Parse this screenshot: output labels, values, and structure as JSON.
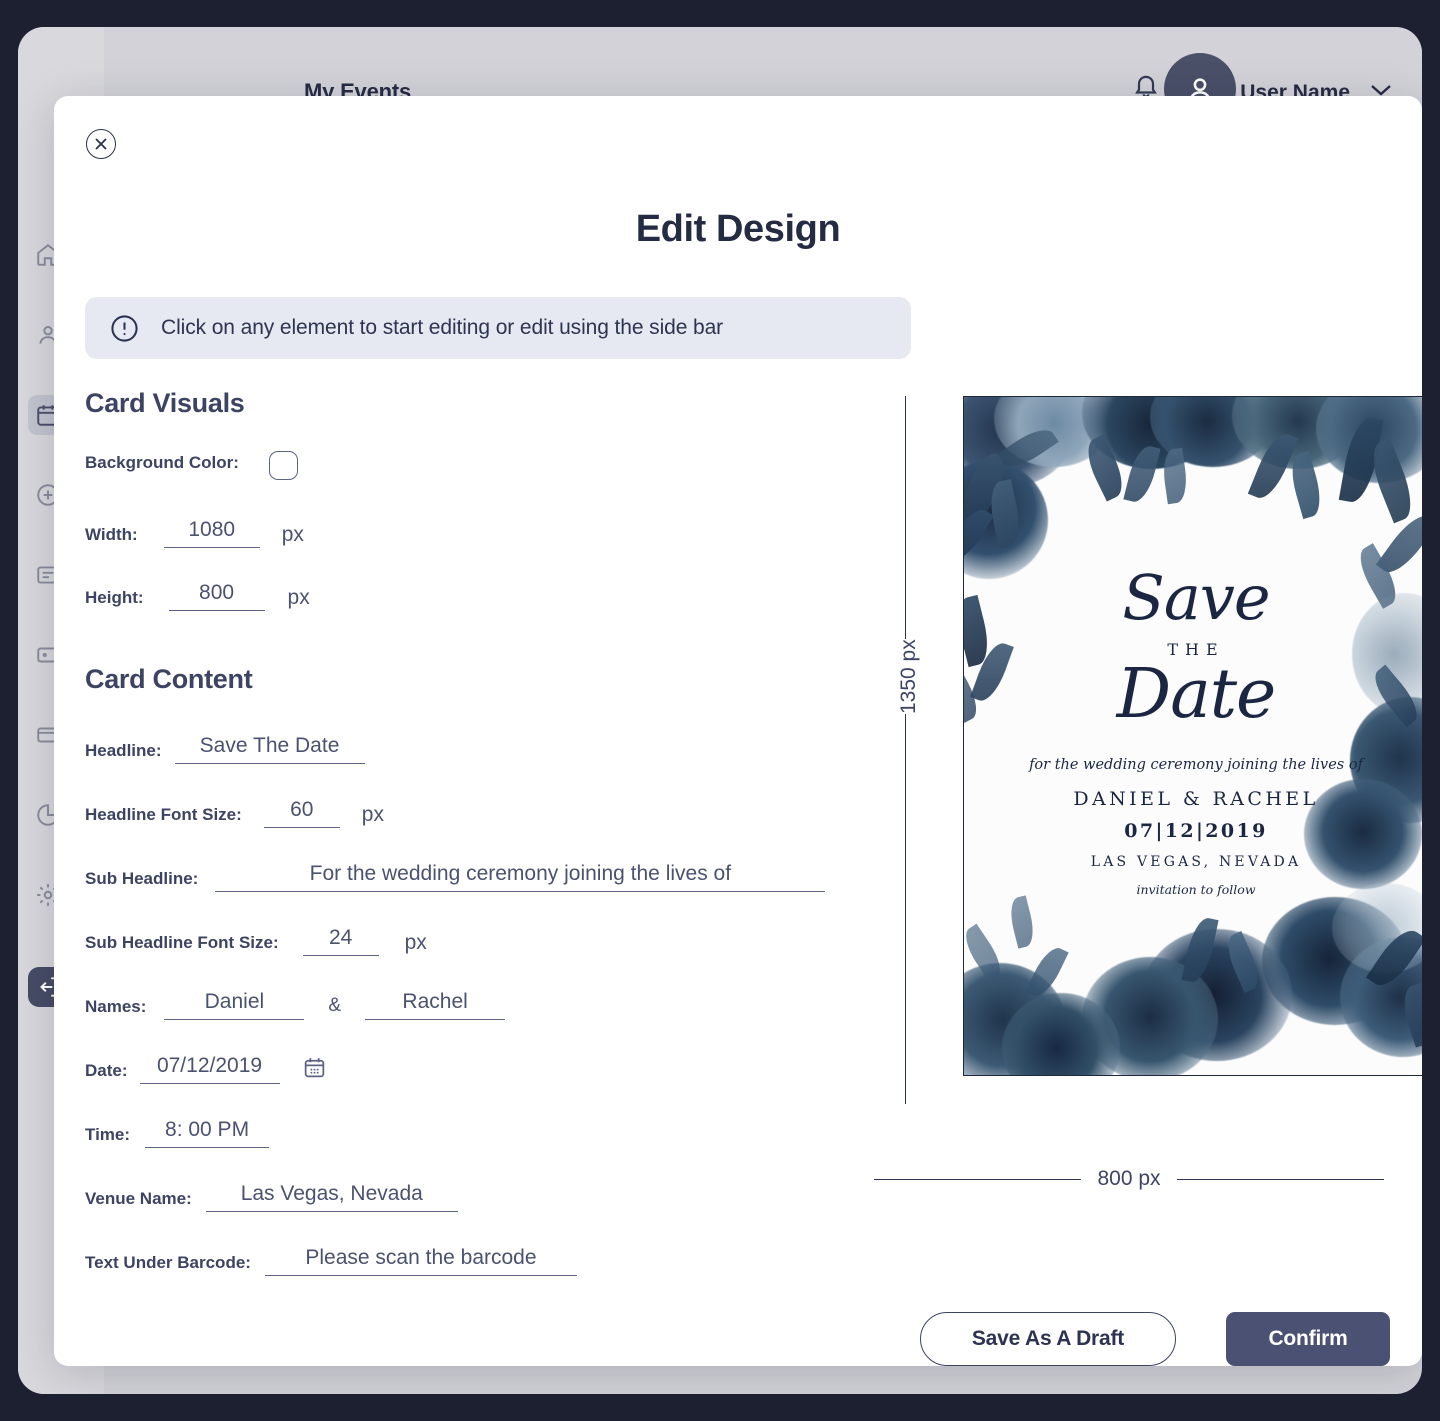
{
  "background_app": {
    "topbar_title": "My Events",
    "user_name": "User Name",
    "bell_icon": "bell-icon",
    "avatar_icon": "user-avatar-icon",
    "chevron_icon": "chevron-down-icon"
  },
  "modal": {
    "title": "Edit Design",
    "close_icon": "close-icon",
    "banner": {
      "icon": "info-exclamation-icon",
      "text": "Click on any  element to start editing or edit using the side bar"
    },
    "sections": {
      "visuals_title": "Card Visuals",
      "content_title": "Card Content"
    },
    "fields": {
      "background_color_label": "Background Color:",
      "background_color_value": "#FFFFFF",
      "width_label": "Width:",
      "width_value": "1080",
      "width_unit": "px",
      "height_label": "Height:",
      "height_value": "800",
      "height_unit": "px",
      "headline_label": "Headline:",
      "headline_value": "Save The Date",
      "headline_fs_label": "Headline Font Size:",
      "headline_fs_value": "60",
      "headline_fs_unit": "px",
      "subheadline_label": "Sub Headline:",
      "subheadline_value": "For the wedding ceremony joining the lives of",
      "subheadline_fs_label": "Sub Headline Font Size:",
      "subheadline_fs_value": "24",
      "subheadline_fs_unit": "px",
      "names_label": "Names:",
      "name_first_value": "Daniel",
      "names_separator": "&",
      "name_second_value": "Rachel",
      "date_label": "Date:",
      "date_value": "07/12/2019",
      "date_icon": "calendar-icon",
      "time_label": "Time:",
      "time_value": "8: 00 PM",
      "venue_label": "Venue Name:",
      "venue_value": "Las Vegas, Nevada",
      "barcode_label": "Text Under Barcode:",
      "barcode_value": "Please scan the barcode"
    },
    "preview": {
      "height_dimension": "1350 px",
      "width_dimension": "800 px",
      "card": {
        "headline_line1": "Save",
        "headline_the": "THE",
        "headline_line2": "Date",
        "sub_headline": "for the wedding ceremony joining the lives of",
        "names": "DANIEL  &  RACHEL",
        "date": "07|12|2019",
        "venue": "LAS VEGAS, NEVADA",
        "footnote": "invitation to follow"
      }
    },
    "footer": {
      "draft_label": "Save As A Draft",
      "confirm_label": "Confirm"
    }
  },
  "colors": {
    "accent_dark": "#4b5173",
    "text_primary": "#262b44",
    "banner_bg": "#e7e9f2",
    "frame": "#1c2030",
    "app_bg": "#d2d2d8",
    "card_ink": "#1b2742"
  }
}
